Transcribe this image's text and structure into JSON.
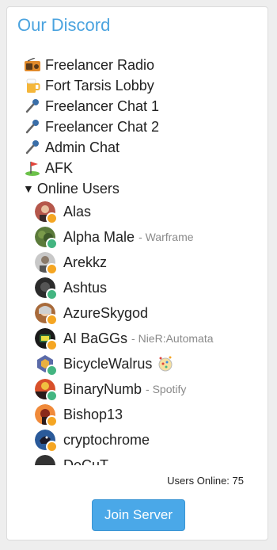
{
  "title": "Our Discord",
  "channels": [
    {
      "icon": "radio-icon",
      "name": "Freelancer Radio"
    },
    {
      "icon": "beer-mug-icon",
      "name": "Fort Tarsis Lobby"
    },
    {
      "icon": "microphone-icon",
      "name": "Freelancer Chat 1"
    },
    {
      "icon": "microphone-icon",
      "name": "Freelancer Chat 2"
    },
    {
      "icon": "microphone-icon",
      "name": "Admin Chat"
    },
    {
      "icon": "golf-flag-icon",
      "name": "AFK"
    }
  ],
  "online_users_label": "Online Users",
  "users": [
    {
      "name": "Alas",
      "game": "",
      "status_color": "#f5a623",
      "avatar_color": "#b5574b"
    },
    {
      "name": "Alpha Male",
      "game": "- Warframe",
      "status_color": "#43b581",
      "avatar_color": "#5b7a3a"
    },
    {
      "name": "Arekkz",
      "game": "",
      "status_color": "#f5a623",
      "avatar_color": "#9a9a9a"
    },
    {
      "name": "Ashtus",
      "game": "",
      "status_color": "#43b581",
      "avatar_color": "#2b2b2b"
    },
    {
      "name": "AzureSkygod",
      "game": "",
      "status_color": "#f5a623",
      "avatar_color": "#a86a3a"
    },
    {
      "name": "AI BaGGs",
      "game": "- NieR:Automata",
      "status_color": "#f5a623",
      "avatar_color": "#243a2a"
    },
    {
      "name": "BicycleWalrus",
      "game": "",
      "status_color": "#43b581",
      "avatar_color": "#5a6aa8",
      "emoji": true
    },
    {
      "name": "BinaryNumb",
      "game": "- Spotify",
      "status_color": "#43b581",
      "avatar_color": "#d8502a"
    },
    {
      "name": "Bishop13",
      "game": "",
      "status_color": "#f5a623",
      "avatar_color": "#c04a1a"
    },
    {
      "name": "cryptochrome",
      "game": "",
      "status_color": "#f5a623",
      "avatar_color": "#2a5a9a"
    },
    {
      "name": "DeCuT",
      "game": "",
      "status_color": "#f5a623",
      "avatar_color": "#333333"
    }
  ],
  "users_online_text": "Users Online: 75",
  "join_label": "Join Server"
}
